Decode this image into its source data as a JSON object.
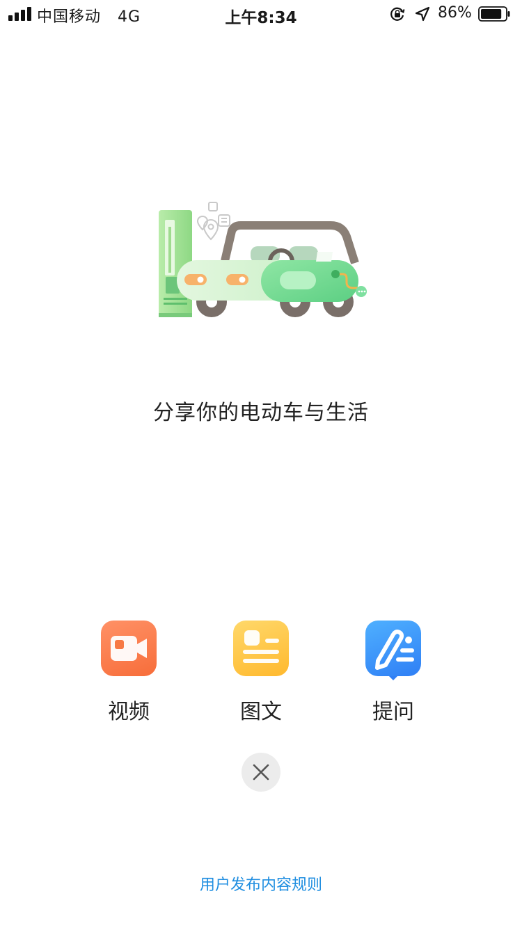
{
  "status_bar": {
    "carrier": "中国移动",
    "network": "4G",
    "time": "上午8:34",
    "battery_percent": "86%",
    "battery_level": 0.86
  },
  "illustration": {
    "icon": "electric-car-charging-illustration"
  },
  "headline": "分享你的电动车与生活",
  "actions": [
    {
      "label": "视频",
      "icon": "video-camera-icon",
      "color": "#f77a45"
    },
    {
      "label": "图文",
      "icon": "article-icon",
      "color": "#ffc53d"
    },
    {
      "label": "提问",
      "icon": "question-edit-icon",
      "color": "#3a8ff8"
    }
  ],
  "close": {
    "icon": "close-icon"
  },
  "footer": {
    "rules_link": "用户发布内容规则",
    "link_color": "#1f8ee0"
  }
}
